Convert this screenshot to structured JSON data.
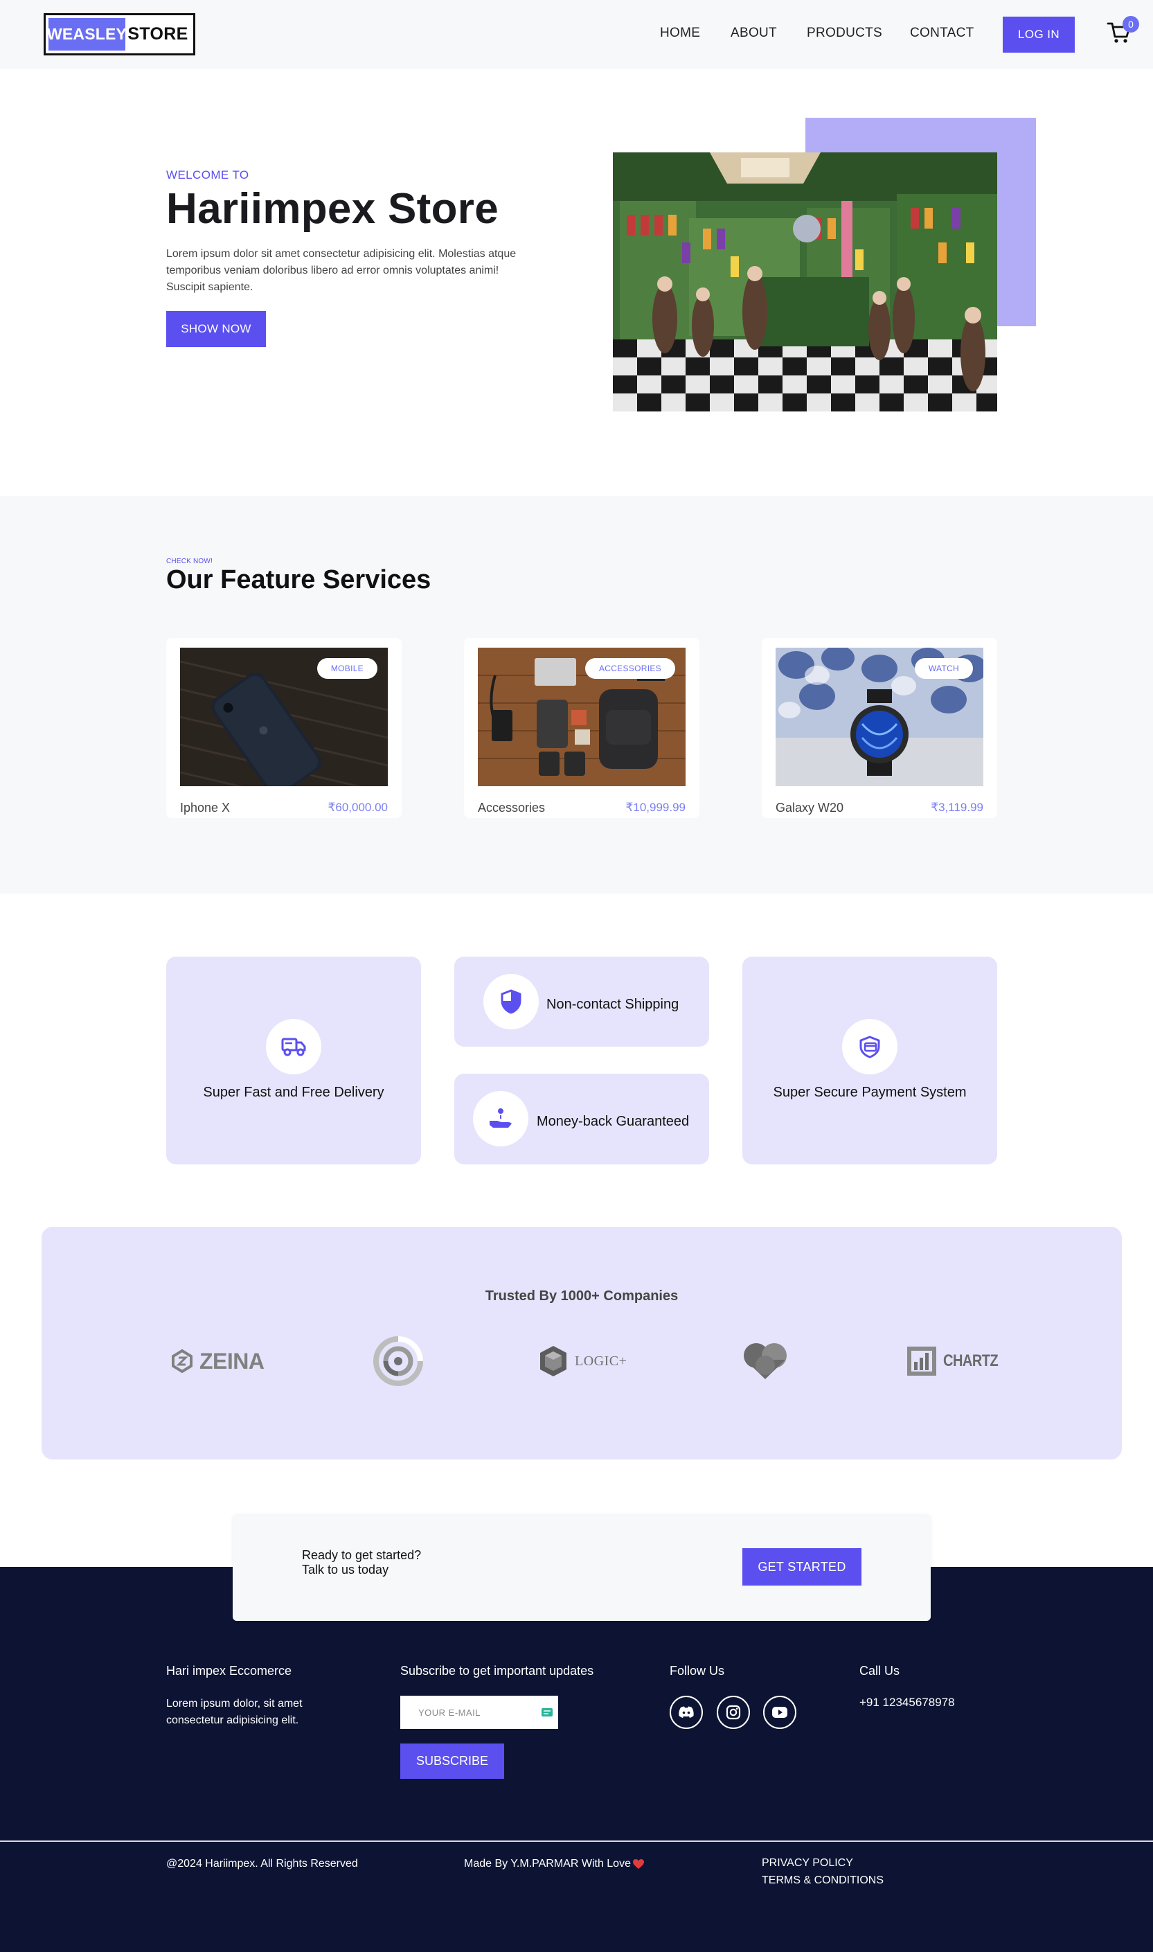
{
  "brand": {
    "logo_left": "WEASLEY",
    "logo_right": "STORE"
  },
  "nav": {
    "links": [
      "HOME",
      "ABOUT",
      "PRODUCTS",
      "CONTACT"
    ],
    "login_label": "LOG IN",
    "cart_count": "0"
  },
  "hero": {
    "eyebrow": "WELCOME TO",
    "title": "Hariimpex Store",
    "description": "Lorem ipsum dolor sit amet consectetur adipisicing elit. Molestias atque temporibus veniam doloribus libero ad error omnis voluptates animi! Suscipit sapiente.",
    "button_label": "SHOW NOW"
  },
  "featured": {
    "eyebrow": "CHECK NOW!",
    "title": "Our Feature Services",
    "products": [
      {
        "tag": "MOBILE",
        "name": "Iphone X",
        "price": "₹60,000.00"
      },
      {
        "tag": "ACCESSORIES",
        "name": "Accessories",
        "price": "₹10,999.99"
      },
      {
        "tag": "WATCH",
        "name": "Galaxy W20",
        "price": "₹3,119.99"
      }
    ]
  },
  "services": {
    "delivery": {
      "label": "Super Fast and Free Delivery",
      "icon": "truck-icon"
    },
    "shipping": {
      "label": "Non-contact Shipping",
      "icon": "shield-icon"
    },
    "moneyback": {
      "label": "Money-back Guaranteed",
      "icon": "hand-coin-icon"
    },
    "payment": {
      "label": "Super Secure Payment System",
      "icon": "secure-card-icon"
    }
  },
  "trusted": {
    "title": "Trusted By 1000+ Companies",
    "logos": [
      "ZEINA",
      "LOGIC+",
      "CHARTZ"
    ]
  },
  "cta": {
    "line1": "Ready to get started?",
    "line2": "Talk to us today",
    "button_label": "GET STARTED"
  },
  "footer": {
    "about_title": "Hari impex Eccomerce",
    "about_text": "Lorem ipsum dolor, sit amet consectetur adipisicing elit.",
    "subscribe_title": "Subscribe to get important updates",
    "email_placeholder": "YOUR E-MAIL",
    "subscribe_label": "SUBSCRIBE",
    "follow_title": "Follow Us",
    "call_title": "Call Us",
    "phone": "+91 12345678978",
    "copyright": "@2024 Hariimpex. All Rights Reserved",
    "made_by": "Made By Y.M.PARMAR With Love",
    "privacy": "PRIVACY POLICY",
    "terms": "TERMS & CONDITIONS"
  },
  "colors": {
    "accent": "#5b4ff0",
    "lavender": "#e6e4fc",
    "footer_bg": "#0d1433"
  }
}
